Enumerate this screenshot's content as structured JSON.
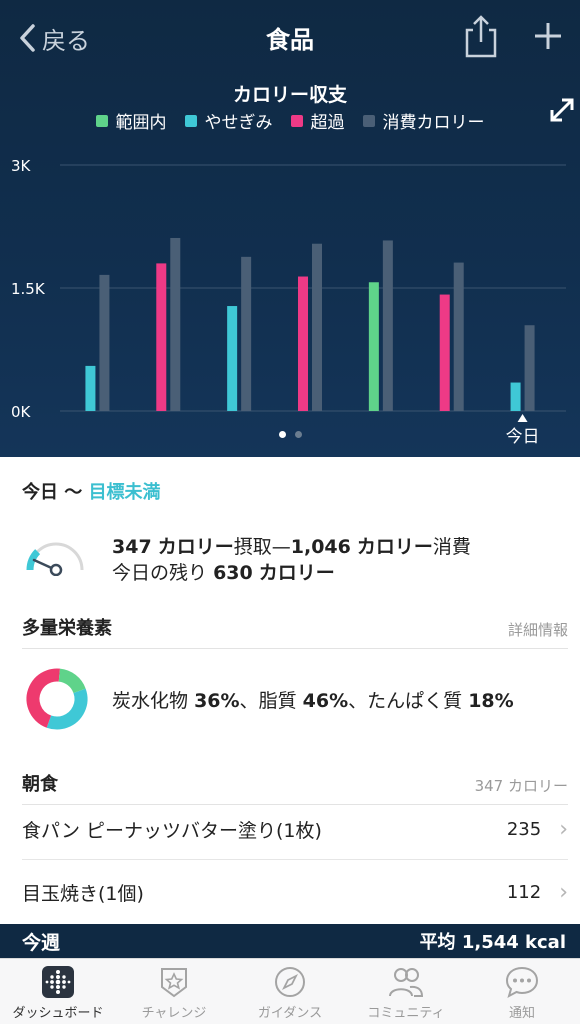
{
  "header": {
    "back_label": "戻る",
    "title": "食品",
    "share_icon": "share-icon",
    "add_icon": "plus-icon"
  },
  "colors": {
    "in_range": "#5fd38a",
    "under": "#3fc8d6",
    "over": "#ee3a86",
    "burned": "#4a5f76",
    "accent": "#3bbfd0",
    "dark_bg": "#0f2943"
  },
  "chart_data": {
    "type": "bar",
    "title": "カロリー収支",
    "legend": [
      "範囲内",
      "やせぎみ",
      "超過",
      "消費カロリー"
    ],
    "legend_placement": "top",
    "yticks": [
      "3K",
      "1.5K",
      "0K"
    ],
    "ylim": [
      0,
      3000
    ],
    "grid": true,
    "today_label": "今日",
    "series": [
      {
        "name": "摂取",
        "values": [
          550,
          1800,
          1280,
          1640,
          1570,
          1420,
          347
        ],
        "status": [
          "under",
          "over",
          "under",
          "over",
          "in_range",
          "over",
          "under"
        ]
      },
      {
        "name": "消費カロリー",
        "values": [
          1660,
          2110,
          1880,
          2040,
          2080,
          1810,
          1046
        ]
      }
    ]
  },
  "pager": {
    "count": 2,
    "active": 0
  },
  "summary": {
    "day": "今日",
    "separator": "〜",
    "status": "目標未満",
    "intake_value": "347",
    "intake_unit": "カロリー",
    "intake_label": "摂取",
    "dash": "—",
    "burn_value": "1,046",
    "burn_unit": "カロリー",
    "burn_label": "消費",
    "remaining_label": "今日の残り",
    "remaining_value": "630",
    "remaining_unit": "カロリー",
    "gauge_fraction": 0.25
  },
  "macros": {
    "title": "多量栄養素",
    "detail_link": "詳細情報",
    "carbs_label": "炭水化物",
    "carbs_value": "36%",
    "sep1": "、",
    "fat_label": "脂質",
    "fat_value": "46%",
    "sep2": "、",
    "protein_label": "たんぱく質",
    "protein_value": "18%",
    "fractions": {
      "carbs": 0.36,
      "fat": 0.46,
      "protein": 0.18
    }
  },
  "breakfast": {
    "title": "朝食",
    "total": "347 カロリー",
    "items": [
      {
        "name": "食パン ピーナッツバター塗り(1枚)",
        "calories": "235"
      },
      {
        "name": "目玉焼き(1個)",
        "calories": "112"
      }
    ]
  },
  "week": {
    "label": "今週",
    "average": "平均 1,544 kcal"
  },
  "tabs": [
    {
      "label": "ダッシュボード",
      "icon": "dashboard-icon",
      "active": true
    },
    {
      "label": "チャレンジ",
      "icon": "star-badge-icon",
      "active": false
    },
    {
      "label": "ガイダンス",
      "icon": "compass-icon",
      "active": false
    },
    {
      "label": "コミュニティ",
      "icon": "people-icon",
      "active": false
    },
    {
      "label": "通知",
      "icon": "chat-bubble-icon",
      "active": false
    }
  ]
}
